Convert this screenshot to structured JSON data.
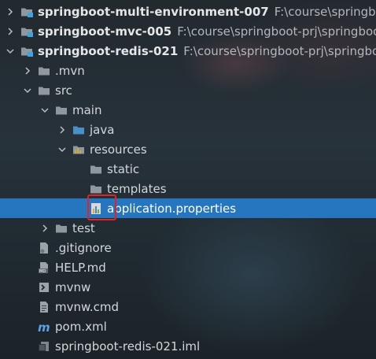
{
  "tree": {
    "items": [
      {
        "name": "springboot-multi-environment-007",
        "path": "F:\\course\\springboot",
        "icon": "module-folder-icon",
        "expanded": false,
        "bold": true,
        "depth": 0
      },
      {
        "name": "springboot-mvc-005",
        "path": "F:\\course\\springboot-prj\\springboo",
        "icon": "module-folder-icon",
        "expanded": false,
        "bold": true,
        "depth": 0
      },
      {
        "name": "springboot-redis-021",
        "path": "F:\\course\\springboot-prj\\springboo",
        "icon": "module-folder-icon",
        "expanded": true,
        "bold": true,
        "depth": 0
      },
      {
        "name": ".mvn",
        "icon": "folder-icon",
        "expanded": false,
        "depth": 1
      },
      {
        "name": "src",
        "icon": "folder-icon",
        "expanded": true,
        "depth": 1
      },
      {
        "name": "main",
        "icon": "folder-icon",
        "expanded": true,
        "depth": 2
      },
      {
        "name": "java",
        "icon": "source-folder-icon",
        "expanded": false,
        "depth": 3
      },
      {
        "name": "resources",
        "icon": "resources-folder-icon",
        "expanded": true,
        "depth": 3
      },
      {
        "name": "static",
        "icon": "folder-icon",
        "depth": 4
      },
      {
        "name": "templates",
        "icon": "folder-icon",
        "depth": 4
      },
      {
        "name": "application.properties",
        "icon": "properties-file-icon",
        "depth": 4,
        "selected": true
      },
      {
        "name": "test",
        "icon": "folder-icon",
        "expanded": false,
        "depth": 2
      },
      {
        "name": ".gitignore",
        "icon": "gitignore-file-icon",
        "depth": 1
      },
      {
        "name": "HELP.md",
        "icon": "markdown-file-icon",
        "depth": 1
      },
      {
        "name": "mvnw",
        "icon": "script-file-icon",
        "depth": 1
      },
      {
        "name": "mvnw.cmd",
        "icon": "text-file-icon",
        "depth": 1
      },
      {
        "name": "pom.xml",
        "icon": "maven-file-icon",
        "depth": 1
      },
      {
        "name": "springboot-redis-021.iml",
        "icon": "iml-file-icon",
        "depth": 1
      }
    ]
  },
  "colors": {
    "selection": "#2675bf",
    "highlight": "#e02424",
    "folder": "#8f989e",
    "source_folder": "#4a90c8",
    "resources_folder": "#b9a35a"
  }
}
